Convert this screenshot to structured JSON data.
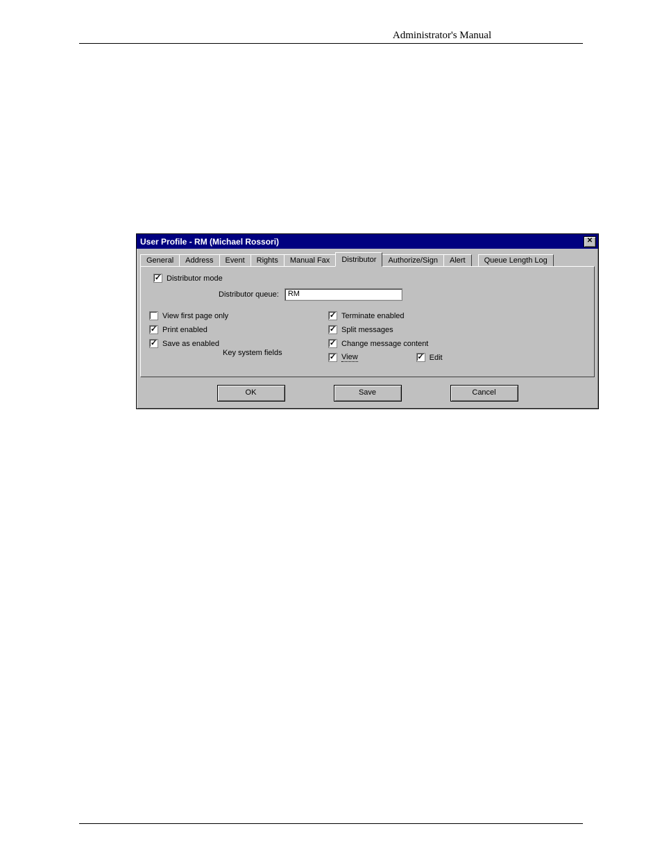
{
  "page_header": "Administrator's Manual",
  "dialog": {
    "title": "User Profile - RM (Michael Rossori)",
    "tabs": [
      "General",
      "Address",
      "Event",
      "Rights",
      "Manual Fax",
      "Distributor",
      "Authorize/Sign",
      "Alert",
      "Queue Length Log"
    ],
    "active_tab_index": 5,
    "distributor_mode": {
      "label": "Distributor mode",
      "checked": true
    },
    "queue_label": "Distributor queue:",
    "queue_value": "RM",
    "left_opts": [
      {
        "label": "View first page only",
        "checked": false
      },
      {
        "label": "Print enabled",
        "checked": true
      },
      {
        "label": "Save as enabled",
        "checked": true
      }
    ],
    "right_opts": [
      {
        "label": "Terminate enabled",
        "checked": true
      },
      {
        "label": "Split messages",
        "checked": true
      },
      {
        "label": "Change message content",
        "checked": true
      }
    ],
    "key_fields_label": "Key system fields",
    "key_view": {
      "label": "View",
      "checked": true
    },
    "key_edit": {
      "label": "Edit",
      "checked": true
    },
    "buttons": {
      "ok": "OK",
      "save": "Save",
      "cancel": "Cancel"
    }
  }
}
